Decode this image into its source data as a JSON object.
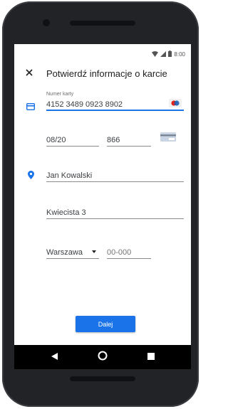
{
  "status": {
    "time": "8:00",
    "icons": [
      "wifi-icon",
      "signal-icon",
      "battery-icon"
    ]
  },
  "header": {
    "title": "Potwierdź informacje o karcie",
    "close_icon": "close-icon"
  },
  "card": {
    "number_label": "Numer karty",
    "number_value": "4152 3489 0923 8902",
    "expiry_value": "08/20",
    "cvc_value": "866"
  },
  "address": {
    "name_value": "Jan Kowalski",
    "street_value": "Kwiecista 3",
    "city_value": "Warszawa",
    "postal_placeholder": "00-000"
  },
  "actions": {
    "next_label": "Dalej"
  },
  "colors": {
    "accent": "#1a73e8",
    "nav_bg": "#000000",
    "device": "#222327"
  }
}
